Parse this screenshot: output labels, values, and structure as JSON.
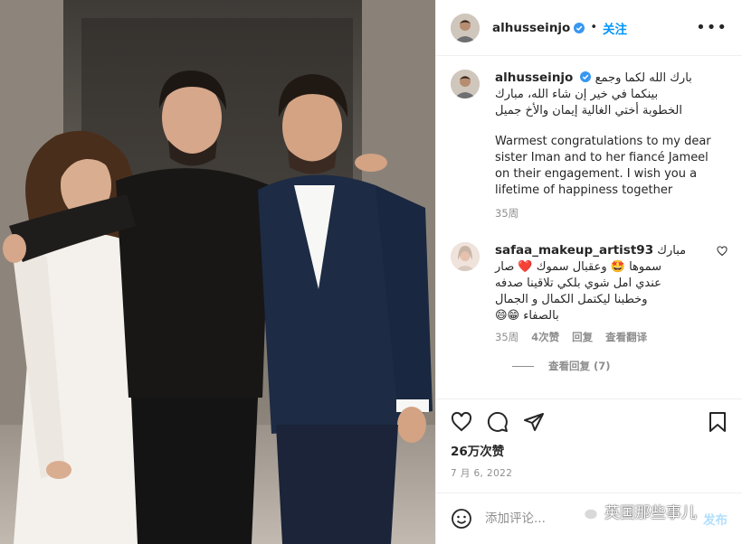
{
  "post": {
    "username": "alhusseinjo",
    "follow_label": "关注",
    "more_label": "•••"
  },
  "caption": {
    "username": "alhusseinjo",
    "arabic_lines": [
      "بارك الله لكما وجمع",
      "بينكما في خير إن شاء الله، مبارك",
      "الخطوبة أختي الغالية إيمان والأخ جميل"
    ],
    "english": "Warmest congratulations to my dear sister Iman and to her fiancé Jameel on their engagement. I wish you a lifetime of happiness together",
    "time": "35周"
  },
  "comment": {
    "username": "safaa_makeup_artist93",
    "first_line_tail": "مبارك",
    "lines": [
      "سموها 🤩 وعقبال سموك ❤️ صار",
      "عندي امل شوي بلكي تلاقينا صدفه",
      "وخطبنا ليكتمل الكمال و الجمال",
      "بالصفاء 😁😄"
    ],
    "time": "35周",
    "likes": "4次赞",
    "reply": "回复",
    "translate": "查看翻译",
    "view_replies": "查看回复 (7)"
  },
  "stats": {
    "likes": "26万次赞",
    "date": "7 月 6, 2022"
  },
  "compose": {
    "placeholder": "添加评论...",
    "post_label": "发布"
  },
  "watermark": {
    "text": "英国那些事儿"
  },
  "colors": {
    "link_blue": "#0095f6",
    "muted": "#8e8e8e",
    "verified": "#3897f0",
    "post_disabled": "#b2dffc"
  },
  "icons": {
    "like": "heart-icon",
    "comment": "comment-bubble-icon",
    "share": "paper-plane-icon",
    "save": "bookmark-icon",
    "emoji": "smiley-icon",
    "verified": "verified-badge-icon",
    "more": "ellipsis-icon",
    "watermark": "wechat-icon"
  }
}
